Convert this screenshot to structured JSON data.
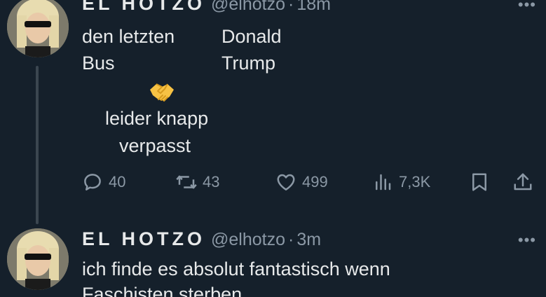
{
  "tweets": [
    {
      "display_name": "EL HOTZO",
      "handle": "@elhotzo",
      "separator": "·",
      "time": "18m",
      "text_col1_line1": "den letzten",
      "text_col1_line2": "Bus",
      "text_col2_line1": "Donald",
      "text_col2_line2": "Trump",
      "emoji": "handshake-emoji",
      "caption_line1": "leider knapp",
      "caption_line2": "verpasst",
      "actions": {
        "replies": "40",
        "reposts": "43",
        "likes": "499",
        "views": "7,3K"
      }
    },
    {
      "display_name": "EL HOTZO",
      "handle": "@elhotzo",
      "separator": "·",
      "time": "3m",
      "text_line1": "ich finde es absolut fantastisch wenn",
      "text_line2": "Faschisten sterben"
    }
  ],
  "colors": {
    "background": "#15202b",
    "text": "#e7e9ea",
    "secondary": "#8b98a5",
    "thread_line": "#3b4650"
  },
  "icons": {
    "more": "more-icon",
    "reply": "reply-icon",
    "repost": "repost-icon",
    "like": "heart-icon",
    "views": "views-icon",
    "bookmark": "bookmark-icon",
    "share": "share-icon"
  }
}
